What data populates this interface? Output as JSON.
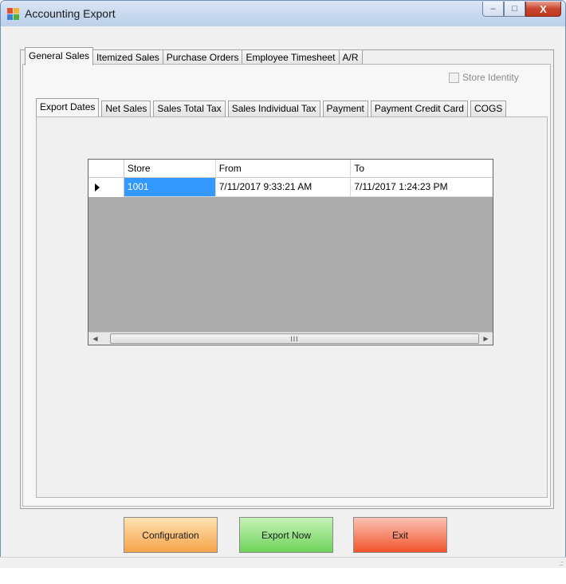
{
  "window": {
    "title": "Accounting Export"
  },
  "caption": {
    "minimize": "–",
    "maximize": "□",
    "close": "X"
  },
  "main_tabs": [
    "General Sales",
    "Itemized Sales",
    "Purchase Orders",
    "Employee Timesheet",
    "A/R"
  ],
  "store_identity_label": "Store Identity",
  "sub_tabs": [
    "Export Dates",
    "Net Sales",
    "Sales Total Tax",
    "Sales Individual Tax",
    "Payment",
    "Payment Credit Card",
    "COGS"
  ],
  "grid": {
    "columns": [
      "Store",
      "From",
      "To"
    ],
    "rows": [
      {
        "store": "1001",
        "from": "7/11/2017 9:33:21 AM",
        "to": "7/11/2017 1:24:23 PM"
      }
    ],
    "scroll_thumb_label": "III"
  },
  "buttons": {
    "configuration": "Configuration",
    "export_now": "Export Now",
    "exit": "Exit"
  },
  "colors": {
    "selected_cell": "#3399ff",
    "configuration": "#f7a34a",
    "export_now": "#6fd35a",
    "exit": "#f0532c"
  }
}
